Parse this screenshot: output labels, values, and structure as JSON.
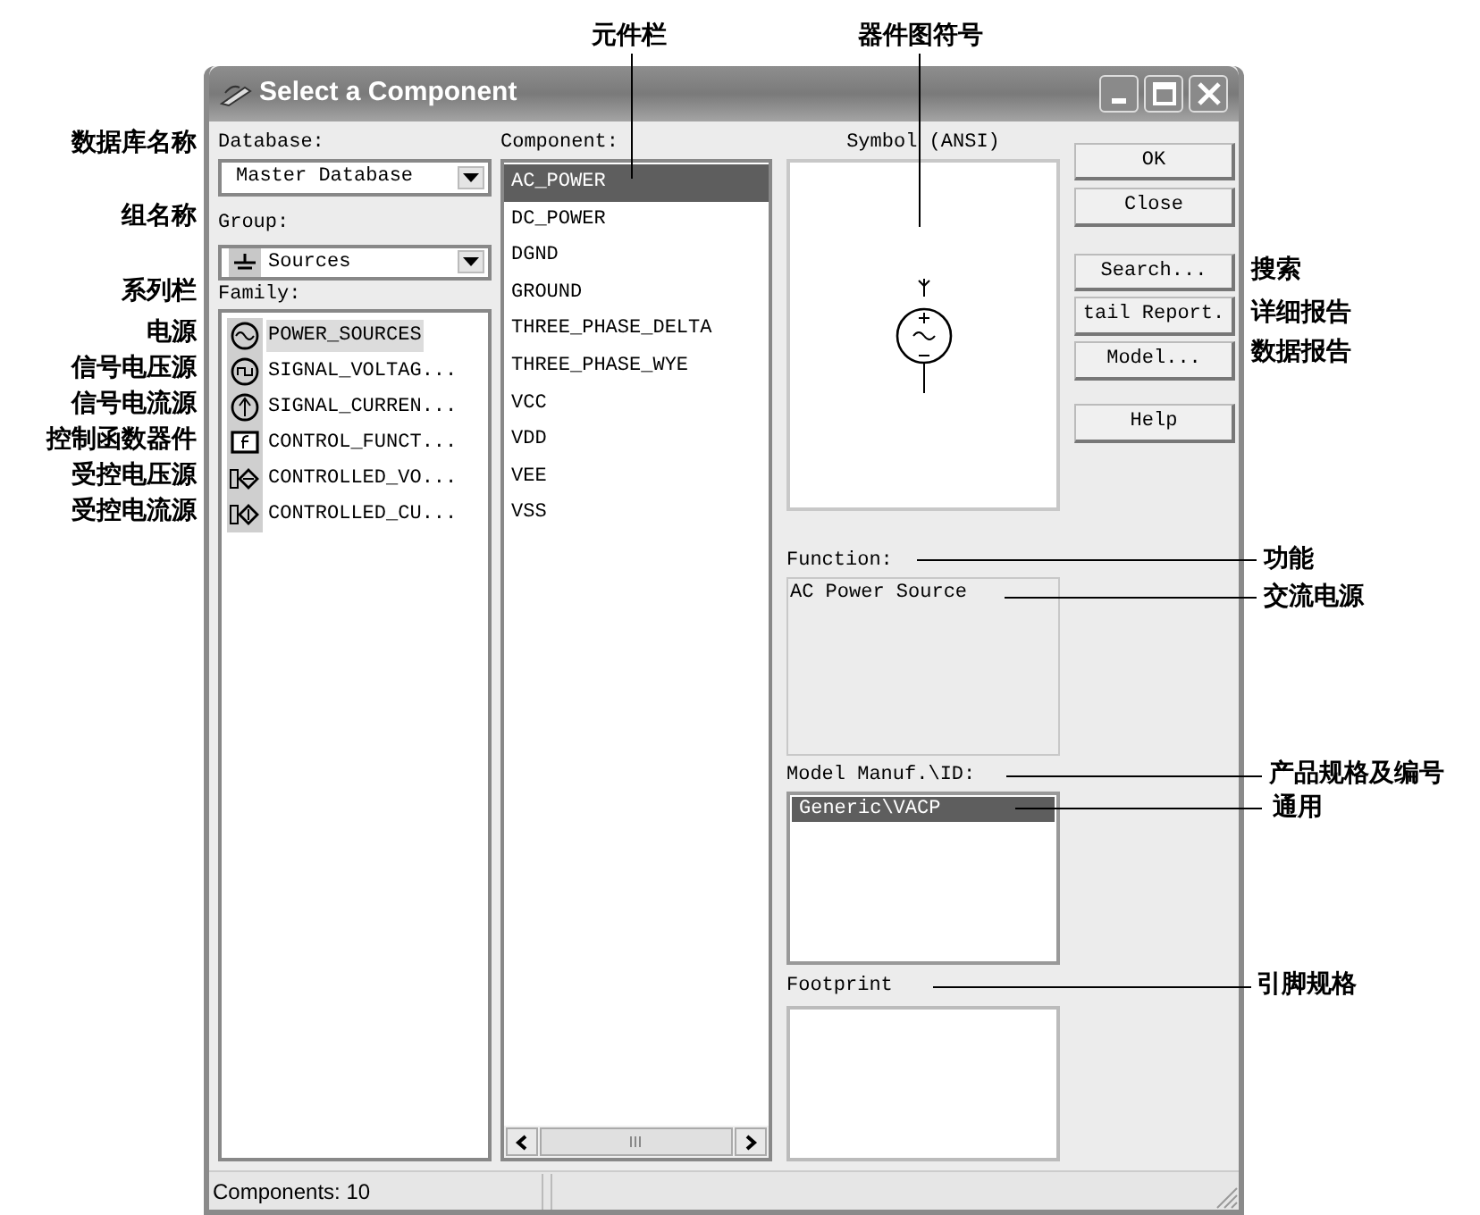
{
  "callouts": [
    "元件栏",
    "器件图符号",
    "数据库名称",
    "组名称",
    "系列栏",
    "电源",
    "信号电压源",
    "信号电流源",
    "控制函数器件",
    "受控电压源",
    "受控电流源",
    "搜索",
    "详细报告",
    "数据报告",
    "功能",
    "交流电源",
    "产品规格及编号",
    "通用",
    "引脚规格"
  ],
  "window": {
    "title": "Select a Component"
  },
  "database": {
    "label": "Database:",
    "value": "Master Database"
  },
  "group": {
    "label": "Group:",
    "value": "Sources"
  },
  "family": {
    "label": "Family:",
    "items": [
      {
        "label": "POWER_SOURCES",
        "selected": true
      },
      {
        "label": "SIGNAL_VOLTAG...",
        "selected": false
      },
      {
        "label": "SIGNAL_CURREN...",
        "selected": false
      },
      {
        "label": "CONTROL_FUNCT...",
        "selected": false
      },
      {
        "label": "CONTROLLED_VO...",
        "selected": false
      },
      {
        "label": "CONTROLLED_CU...",
        "selected": false
      }
    ]
  },
  "component": {
    "label": "Component:",
    "items": [
      {
        "label": "AC_POWER",
        "selected": true
      },
      {
        "label": "DC_POWER",
        "selected": false
      },
      {
        "label": "DGND",
        "selected": false
      },
      {
        "label": "GROUND",
        "selected": false
      },
      {
        "label": "THREE_PHASE_DELTA",
        "selected": false
      },
      {
        "label": "THREE_PHASE_WYE",
        "selected": false
      },
      {
        "label": "VCC",
        "selected": false
      },
      {
        "label": "VDD",
        "selected": false
      },
      {
        "label": "VEE",
        "selected": false
      },
      {
        "label": "VSS",
        "selected": false
      }
    ]
  },
  "symbol": {
    "label": "Symbol (ANSI)"
  },
  "function": {
    "label": "Function:",
    "value": "AC Power Source"
  },
  "model": {
    "label": "Model Manuf.\\ID:",
    "items": [
      {
        "label": "Generic\\VACP",
        "selected": true
      }
    ]
  },
  "footprint": {
    "label": "Footprint"
  },
  "buttons": [
    "OK",
    "Close",
    "Search...",
    "tail Report.",
    "Model...",
    "Help"
  ],
  "status_bar": [
    "Components: 10"
  ]
}
